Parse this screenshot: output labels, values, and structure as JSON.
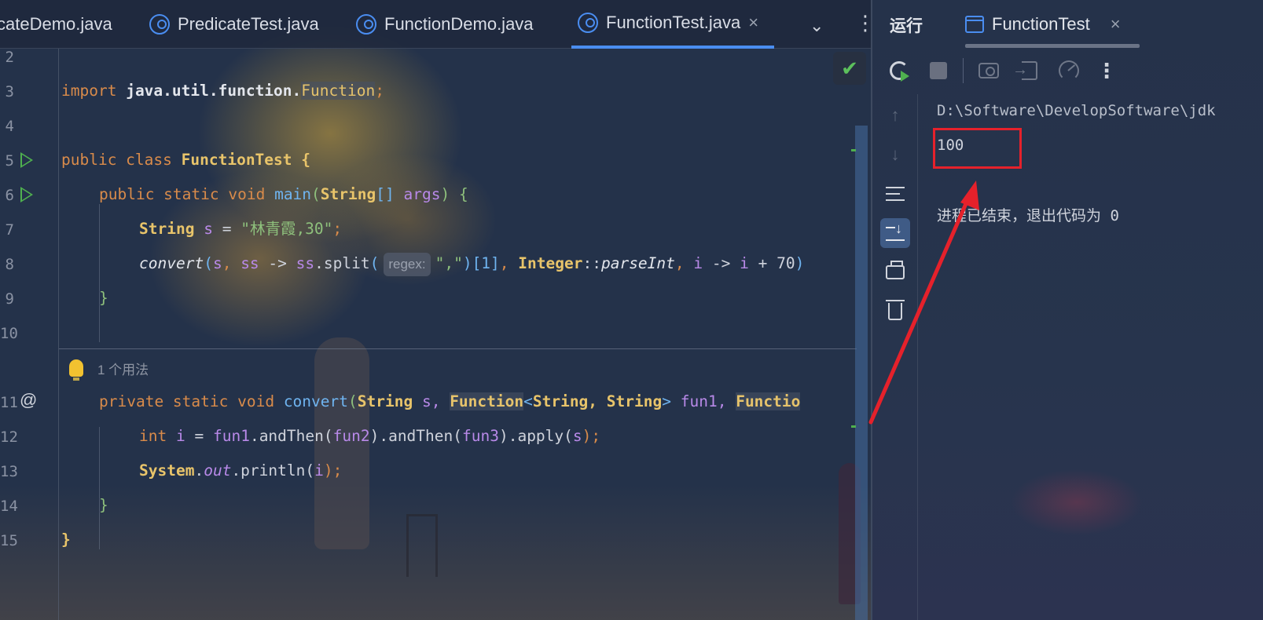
{
  "tabs": [
    {
      "label": "cateDemo.java",
      "icon": "java-class-icon"
    },
    {
      "label": "PredicateTest.java",
      "icon": "java-class-icon"
    },
    {
      "label": "FunctionDemo.java",
      "icon": "java-class-icon"
    },
    {
      "label": "FunctionTest.java",
      "icon": "java-class-icon",
      "active": true,
      "close": "×"
    }
  ],
  "tab_controls": {
    "more": "⌄",
    "menu": "⋮"
  },
  "line_numbers": [
    "2",
    "3",
    "4",
    "5",
    "6",
    "7",
    "8",
    "9",
    "10",
    "11",
    "12",
    "13",
    "14",
    "15"
  ],
  "code": {
    "l3": {
      "kw": "import",
      "pkg": "java.util.function.",
      "cls": "Function",
      "semi": ";"
    },
    "l5": {
      "kw": "public class",
      "name": "FunctionTest",
      "brace": "{"
    },
    "l6": {
      "kw": "public static void",
      "fn": "main",
      "open": "(",
      "type": "String",
      "arr": "[]",
      "param": "args",
      "close": ")",
      "brace": "{"
    },
    "l7": {
      "type": "String",
      "var": "s",
      "eq": "=",
      "str": "\"林青霞,30\"",
      "semi": ";"
    },
    "l8": {
      "fn": "convert",
      "p1": "s",
      "p2": "ss",
      "arrow": "->",
      "call": "ss.split(",
      "hint": "regex:",
      "str": "\",\"",
      "idx": ")[1],",
      "cls": "Integer",
      "ref": "::",
      "method": "parseInt",
      "lam": "i",
      "arrow2": "->",
      "expr": "i + 70)"
    },
    "l9": {
      "brace": "}"
    },
    "usage_hint": "1 个用法",
    "l11": {
      "kw": "private static void",
      "fn": "convert",
      "open": "(",
      "t1": "String",
      "p1": "s,",
      "t2": "Function",
      "gen_open": "<",
      "t3": "String,",
      "t4": "String",
      "gen_close": ">",
      "p2": "fun1,",
      "t5": "Functio"
    },
    "l12": {
      "kw": "int",
      "var": "i",
      "eq": "=",
      "p1": "fun1",
      "m1": ".andThen(",
      "p2": "fun2",
      "m2": ").andThen(",
      "p3": "fun3",
      "m3": ").apply(",
      "p4": "s",
      "end": ");"
    },
    "l13": {
      "cls": "System",
      "dot": ".",
      "field": "out",
      "call": ".println(",
      "arg": "i",
      "end": ");"
    },
    "l14": {
      "brace": "}"
    },
    "l15": {
      "brace": "}"
    }
  },
  "editor_status": {
    "check": "✔"
  },
  "run_panel": {
    "title": "运行",
    "tab_label": "FunctionTest",
    "tab_close": "×",
    "toolbar_more": "⋮",
    "console": {
      "path": "D:\\Software\\DevelopSoftware\\jdk",
      "output": "100",
      "exit": "进程已结束，退出代码为 0"
    },
    "nav_up": "↑",
    "nav_down": "↓"
  },
  "colors": {
    "accent": "#4a8df0",
    "run_green": "#4fb04f",
    "annotation_red": "#e5212b"
  }
}
